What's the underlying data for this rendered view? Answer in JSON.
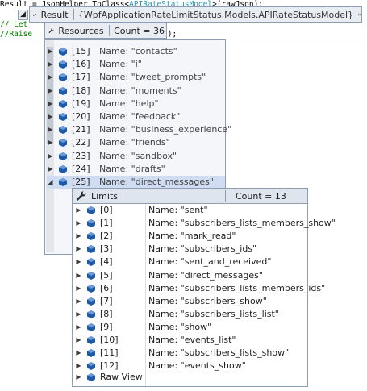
{
  "code": {
    "line1_pre": "Result = JsonHelper.ToClass<",
    "line1_type": "APIRateStatusModel",
    "line1_post": ">(rawJson);",
    "line2": "// Let",
    "line3": "//Raise",
    "line3_tail": "d);"
  },
  "result_tip": {
    "label": "Result",
    "value": "{WpfApplicationRateLimitStatus.Models.APIRateStatusModel}"
  },
  "resources_tip": {
    "label": "Resources",
    "count": "Count = 36",
    "rows": [
      {
        "index": "[15]",
        "name": "Name: \"contacts\""
      },
      {
        "index": "[16]",
        "name": "Name: \"i\""
      },
      {
        "index": "[17]",
        "name": "Name: \"tweet_prompts\""
      },
      {
        "index": "[18]",
        "name": "Name: \"moments\""
      },
      {
        "index": "[19]",
        "name": "Name: \"help\""
      },
      {
        "index": "[20]",
        "name": "Name: \"feedback\""
      },
      {
        "index": "[21]",
        "name": "Name: \"business_experience\""
      },
      {
        "index": "[22]",
        "name": "Name: \"friends\""
      },
      {
        "index": "[23]",
        "name": "Name: \"sandbox\""
      },
      {
        "index": "[24]",
        "name": "Name: \"drafts\""
      },
      {
        "index": "[25]",
        "name": "Name: \"direct_messages\""
      }
    ]
  },
  "limits_tip": {
    "label": "Limits",
    "count": "Count = 13",
    "rows": [
      {
        "index": "[0]",
        "name": "Name: \"sent\""
      },
      {
        "index": "[1]",
        "name": "Name: \"subscribers_lists_members_show\""
      },
      {
        "index": "[2]",
        "name": "Name: \"mark_read\""
      },
      {
        "index": "[3]",
        "name": "Name: \"subscribers_ids\""
      },
      {
        "index": "[4]",
        "name": "Name: \"sent_and_received\""
      },
      {
        "index": "[5]",
        "name": "Name: \"direct_messages\""
      },
      {
        "index": "[6]",
        "name": "Name: \"subscribers_lists_members_ids\""
      },
      {
        "index": "[7]",
        "name": "Name: \"subscribers_show\""
      },
      {
        "index": "[8]",
        "name": "Name: \"subscribers_lists_list\""
      },
      {
        "index": "[9]",
        "name": "Name: \"show\""
      },
      {
        "index": "[10]",
        "name": "Name: \"events_list\""
      },
      {
        "index": "[11]",
        "name": "Name: \"subscribers_lists_show\""
      },
      {
        "index": "[12]",
        "name": "Name: \"events_show\""
      }
    ],
    "raw_view": "Raw View"
  },
  "icons": {
    "wrench": "wrench-icon",
    "pin": "pin-icon",
    "object": "object-cube-icon",
    "expand": "expand-arrow-icon"
  },
  "colors": {
    "selection": "#cfdcf1",
    "cube": "#1e5aa8",
    "border": "#8e9db3"
  }
}
